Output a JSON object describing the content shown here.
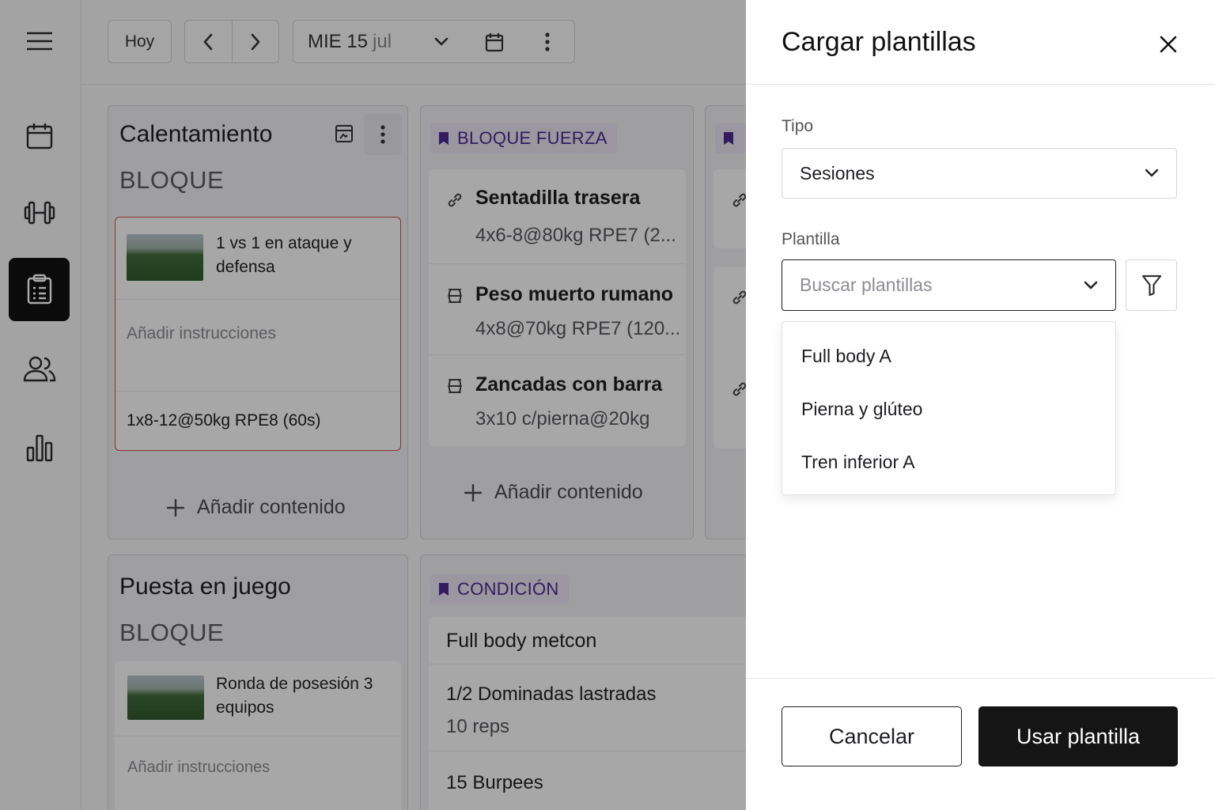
{
  "toolbar": {
    "today_label": "Hoy",
    "date_day": "MIE 15",
    "date_month": "jul"
  },
  "columns": [
    {
      "title": "Calentamiento",
      "subtitle": "BLOQUE",
      "card": {
        "title": "1 vs 1 en ataque y defensa",
        "instructions_placeholder": "Añadir instrucciones",
        "prescription": "1x8-12@50kg RPE8 (60s)"
      },
      "add_label": "Añadir contenido"
    },
    {
      "tag": "BLOQUE FUERZA",
      "exercises": [
        {
          "name": "Sentadilla trasera",
          "detail": "4x6-8@80kg RPE7 (2...",
          "icon": "link-icon"
        },
        {
          "name": "Peso muerto rumano",
          "detail": "4x8@70kg RPE7 (120...",
          "icon": "superset-icon"
        },
        {
          "name": "Zancadas con barra",
          "detail": "3x10 c/pierna@20kg",
          "icon": "superset-icon"
        }
      ],
      "add_label": "Añadir contenido"
    },
    {
      "title": "Puesta en juego",
      "subtitle": "BLOQUE",
      "card": {
        "title": "Ronda de posesión 3 equipos",
        "instructions_placeholder": "Añadir instrucciones"
      }
    },
    {
      "tag": "CONDICIÓN",
      "workout_title": "Full body metcon",
      "items": [
        {
          "name": "1/2 Dominadas lastradas",
          "detail": "10 reps"
        },
        {
          "name": "15 Burpees",
          "detail": ""
        }
      ]
    }
  ],
  "drawer": {
    "title": "Cargar plantillas",
    "type_label": "Tipo",
    "type_value": "Sesiones",
    "template_label": "Plantilla",
    "template_placeholder": "Buscar plantillas",
    "options": [
      "Full body A",
      "Pierna y glúteo",
      "Tren inferior A"
    ],
    "cancel_label": "Cancelar",
    "use_label": "Usar plantilla"
  },
  "colors": {
    "accent_purple": "#4b2a8c",
    "error_border": "#c94a4a",
    "primary_button": "#151515"
  }
}
